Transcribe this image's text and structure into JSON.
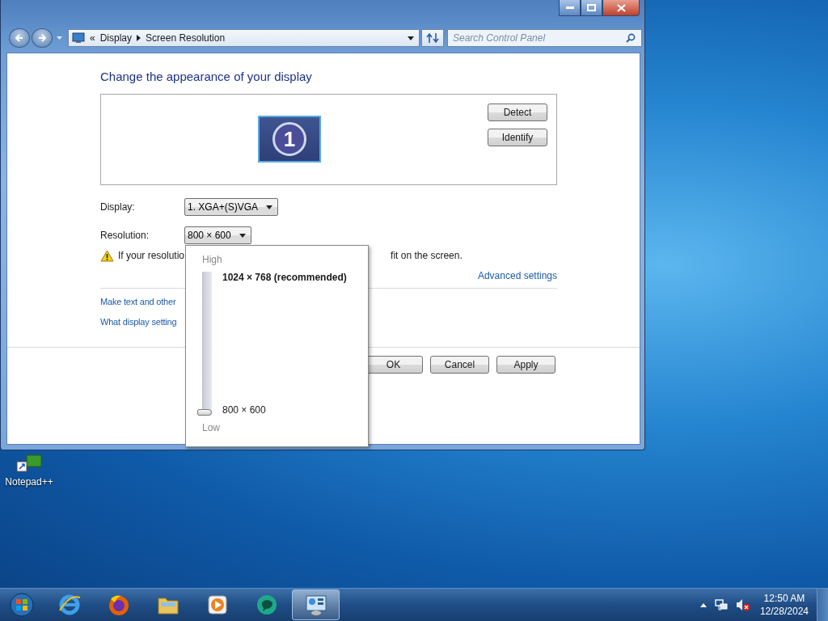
{
  "address_bar": {
    "overflow": "«",
    "crumbs": [
      "Display",
      "Screen Resolution"
    ]
  },
  "search": {
    "placeholder": "Search Control Panel"
  },
  "heading": "Change the appearance of your display",
  "monitor_preview": {
    "number": "1"
  },
  "preview_buttons": [
    "Detect",
    "Identify"
  ],
  "fields": [
    {
      "label": "Display:",
      "value": "1. XGA+(S)VGA"
    },
    {
      "label": "Resolution:",
      "value": "800 × 600"
    }
  ],
  "warning": [
    "If your resolutio",
    "fit on the screen."
  ],
  "advanced_link": "Advanced settings",
  "links": [
    "Make text and other",
    "What display setting"
  ],
  "dialog_buttons": [
    "OK",
    "Cancel",
    "Apply"
  ],
  "resolution_popup": {
    "high_label": "High",
    "top_option": "1024 × 768 (recommended)",
    "bottom_option": "800 × 600",
    "low_label": "Low",
    "level": 0
  },
  "desktop_icons": [
    {
      "label": "Notepad++"
    }
  ],
  "taskbar": {
    "apps": [
      {
        "kind": "browser-e",
        "selected": false
      },
      {
        "kind": "browser-fox",
        "selected": false
      },
      {
        "kind": "folder",
        "selected": false
      },
      {
        "kind": "media",
        "selected": false
      },
      {
        "kind": "bubble",
        "selected": false
      },
      {
        "kind": "control-panel",
        "selected": true
      }
    ],
    "time": "12:50 AM",
    "date": "12/28/2024"
  }
}
